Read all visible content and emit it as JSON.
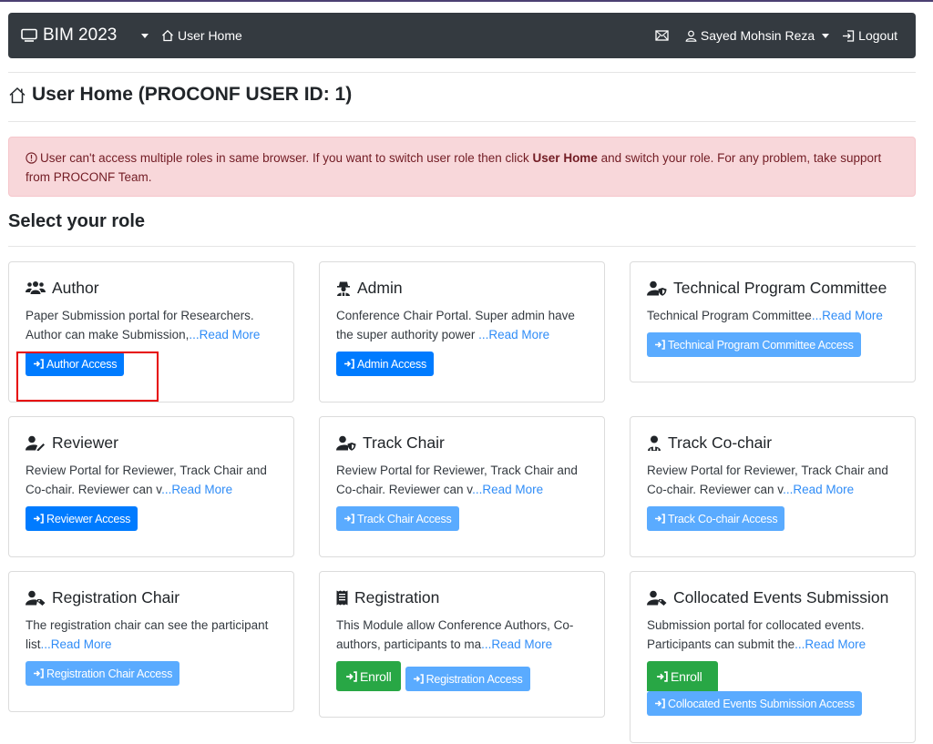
{
  "navbar": {
    "brand": "BIM 2023",
    "home_label": "User Home",
    "user_name": "Sayed Mohsin Reza",
    "logout_label": "Logout"
  },
  "page": {
    "title": "User Home (PROCONF USER ID: 1)",
    "section_title": "Select your role"
  },
  "alert": {
    "text_before": "User can't access multiple roles in same browser. If you want to switch user role then click ",
    "bold": "User Home",
    "text_after": " and switch your role. For any problem, take support from PROCONF Team."
  },
  "roles": [
    {
      "title": "Author",
      "icon": "users-icon",
      "desc": "Paper Submission portal for Researchers. Author can make Submission,",
      "read_more": "...Read More",
      "buttons": [
        {
          "label": "Author Access",
          "style": "primary"
        }
      ]
    },
    {
      "title": "Admin",
      "icon": "user-secret-icon",
      "desc": "Conference Chair Portal. Super admin have the super authority power ",
      "read_more": "...Read More",
      "buttons": [
        {
          "label": "Admin Access",
          "style": "primary"
        }
      ]
    },
    {
      "title": "Technical Program Committee",
      "icon": "user-shield-icon",
      "desc": "Technical Program Committee",
      "read_more": "...Read More",
      "buttons": [
        {
          "label": "Technical Program Committee Access",
          "style": "disabled"
        }
      ]
    },
    {
      "title": "Reviewer",
      "icon": "user-edit-icon",
      "desc": "Review Portal for Reviewer, Track Chair and Co-chair. Reviewer can v",
      "read_more": "...Read More",
      "buttons": [
        {
          "label": "Reviewer Access",
          "style": "primary"
        }
      ]
    },
    {
      "title": "Track Chair",
      "icon": "user-shield-icon",
      "desc": "Review Portal for Reviewer, Track Chair and Co-chair. Reviewer can v",
      "read_more": "...Read More",
      "buttons": [
        {
          "label": "Track Chair Access",
          "style": "disabled"
        }
      ]
    },
    {
      "title": "Track Co-chair",
      "icon": "user-tie-icon",
      "desc": "Review Portal for Reviewer, Track Chair and Co-chair. Reviewer can v",
      "read_more": "...Read More",
      "buttons": [
        {
          "label": "Track Co-chair Access",
          "style": "disabled"
        }
      ]
    },
    {
      "title": "Registration Chair",
      "icon": "user-tag-icon",
      "desc": "The registration chair can see the participant list",
      "read_more": "...Read More",
      "buttons": [
        {
          "label": "Registration Chair Access",
          "style": "disabled"
        }
      ]
    },
    {
      "title": "Registration",
      "icon": "receipt-icon",
      "desc": "This Module allow Conference Authors, Co-authors, participants to ma",
      "read_more": "...Read More",
      "buttons": [
        {
          "label": "Enroll",
          "style": "success"
        },
        {
          "label": "Registration Access",
          "style": "disabled"
        }
      ]
    },
    {
      "title": "Collocated Events Submission",
      "icon": "user-tag-icon",
      "desc": "Submission portal for collocated events. Participants can submit the",
      "read_more": "...Read More",
      "buttons": [
        {
          "label": "Enroll",
          "style": "success"
        },
        {
          "label": "Collocated Events Submission Access",
          "style": "disabled"
        }
      ]
    }
  ],
  "colors": {
    "navbar_bg": "#343a40",
    "primary": "#007bff",
    "primary_disabled": "#5aabff",
    "success": "#28a745",
    "alert_bg": "#f8d7da",
    "alert_text": "#721c24",
    "highlight": "#e60000"
  }
}
